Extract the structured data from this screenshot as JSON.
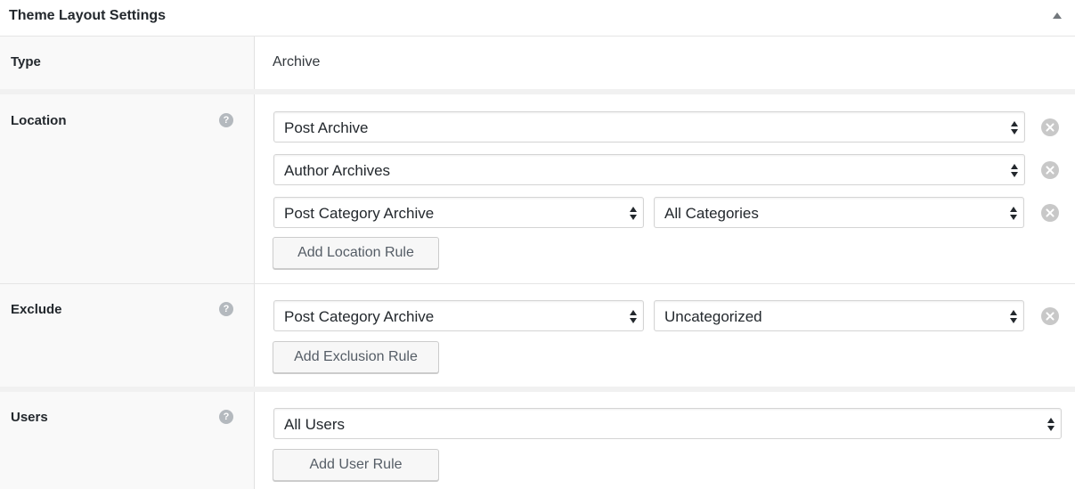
{
  "panel": {
    "title": "Theme Layout Settings"
  },
  "type_row": {
    "label": "Type",
    "value": "Archive"
  },
  "location_row": {
    "label": "Location",
    "help": "?",
    "rules": [
      {
        "primary": "Post Archive"
      },
      {
        "primary": "Author Archives"
      },
      {
        "primary": "Post Category Archive",
        "secondary": "All Categories"
      }
    ],
    "add_button": "Add Location Rule"
  },
  "exclude_row": {
    "label": "Exclude",
    "help": "?",
    "rules": [
      {
        "primary": "Post Category Archive",
        "secondary": "Uncategorized"
      }
    ],
    "add_button": "Add Exclusion Rule"
  },
  "users_row": {
    "label": "Users",
    "help": "?",
    "rules": [
      {
        "primary": "All Users"
      }
    ],
    "add_button": "Add User Rule"
  }
}
